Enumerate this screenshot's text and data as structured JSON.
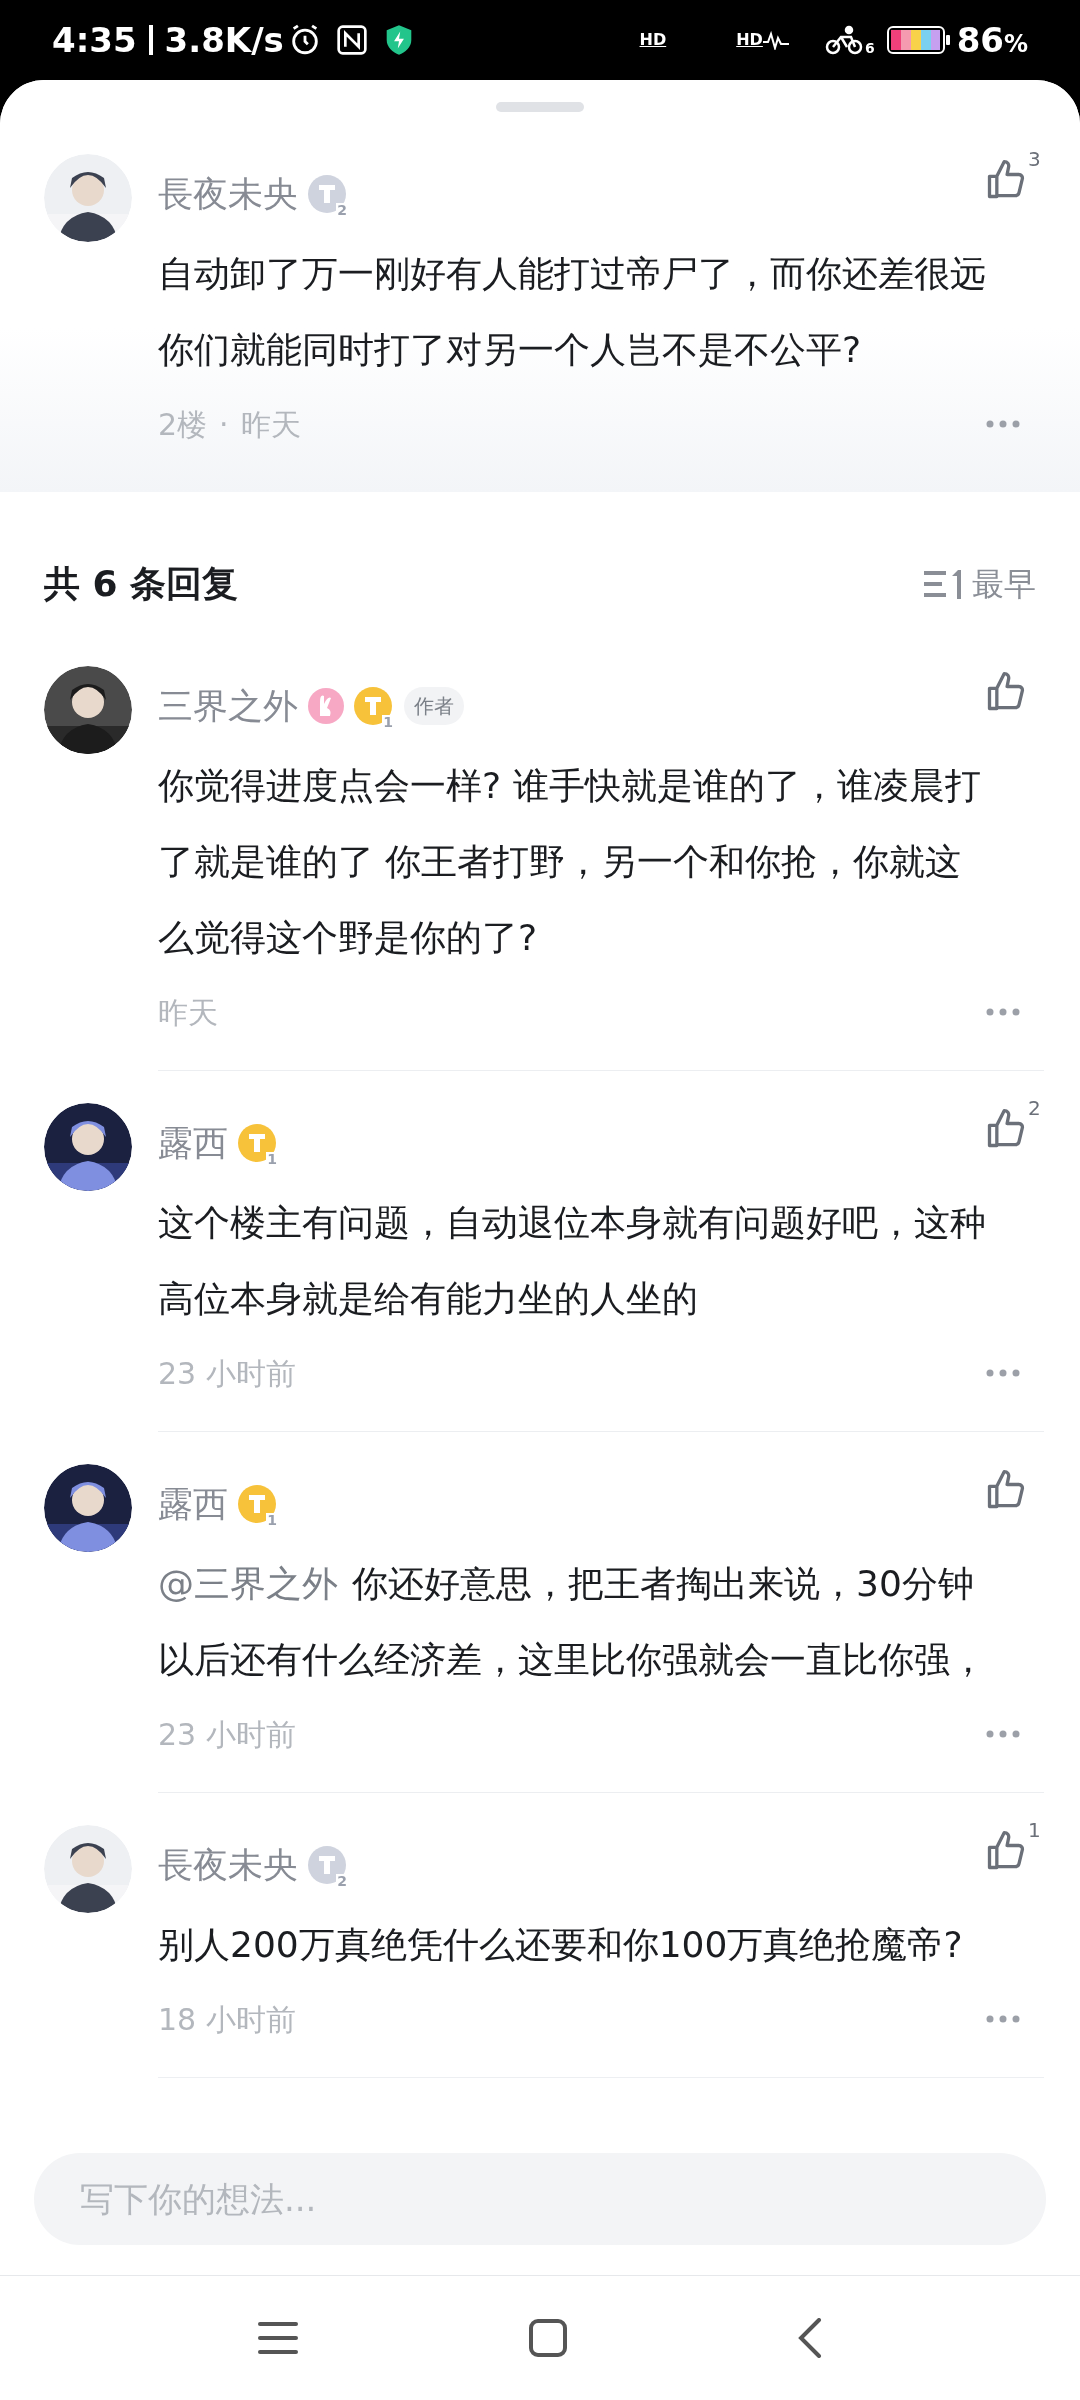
{
  "status_bar": {
    "time": "4:35",
    "speed": "3.8K/s",
    "hd_labels": [
      "HD",
      "HD"
    ],
    "bike_count": "6",
    "battery": "86",
    "battery_unit": "%"
  },
  "main_comment": {
    "name": "長夜未央",
    "badge": {
      "color": "#cfd3de",
      "rank": "2"
    },
    "likes": "3",
    "text": "自动卸了万一刚好有人能打过帝尸了，而你还差很远你们就能同时打了对另一个人岂不是不公平?",
    "floor": "2楼",
    "separator": "·",
    "time": "昨天"
  },
  "replies_header": {
    "title": "共 6 条回复",
    "sort": "最早"
  },
  "replies": [
    {
      "name": "三界之外",
      "year_badge": true,
      "badge": {
        "color": "#f7c23a",
        "rank": "1"
      },
      "tag": "作者",
      "text": "你觉得进度点会一样? 谁手快就是谁的了，谁凌晨打了就是谁的了 你王者打野，另一个和你抢，你就这么觉得这个野是你的了?",
      "time": "昨天"
    },
    {
      "name": "露西",
      "year_badge": false,
      "badge": {
        "color": "#f7c23a",
        "rank": "1"
      },
      "likes": "2",
      "text": "这个楼主有问题，自动退位本身就有问题好吧，这种高位本身就是给有能力坐的人坐的",
      "time": "23 小时前"
    },
    {
      "name": "露西",
      "year_badge": false,
      "badge": {
        "color": "#f7c23a",
        "rank": "1"
      },
      "mention": "@三界之外",
      "text": "你还好意思，把王者掏出来说，30分钟以后还有什么经济差，这里比你强就会一直比你强，",
      "time": "23 小时前"
    },
    {
      "name": "長夜未央",
      "year_badge": false,
      "badge": {
        "color": "#cfd3de",
        "rank": "2"
      },
      "likes": "1",
      "text": "别人200万真绝凭什么还要和你100万真绝抢魔帝?",
      "time": "18 小时前"
    }
  ],
  "input": {
    "placeholder": "写下你的想法..."
  }
}
